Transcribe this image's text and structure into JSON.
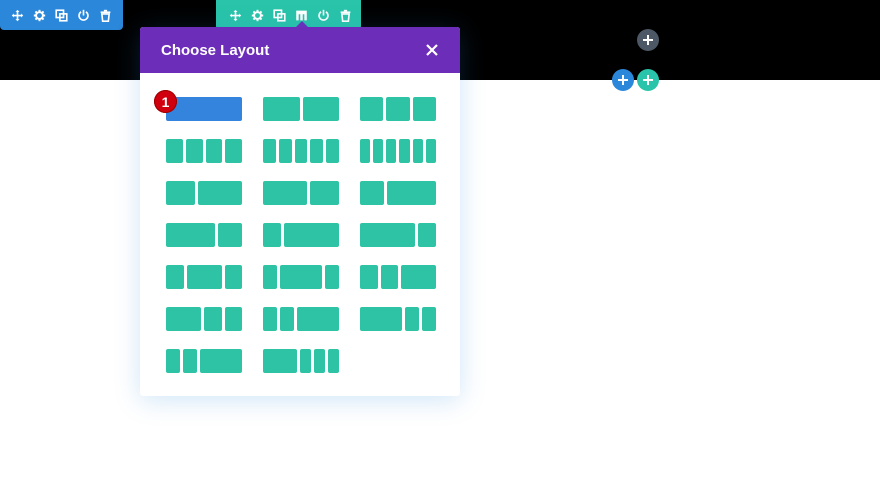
{
  "colors": {
    "section_toolbar": "#2b87da",
    "row_toolbar": "#29c4a9",
    "modal_header": "#6c2eb9",
    "layout_column": "#2fc3a5",
    "layout_selected": "#3483dc",
    "badge": "#d1000e"
  },
  "section_toolbar": {
    "icons": [
      "move-icon",
      "gear-icon",
      "duplicate-icon",
      "power-icon",
      "trash-icon"
    ]
  },
  "row_toolbar": {
    "icons": [
      "move-icon",
      "gear-icon",
      "duplicate-icon",
      "columns-icon",
      "power-icon",
      "trash-icon"
    ]
  },
  "modal": {
    "title": "Choose Layout",
    "close_icon": "close-icon",
    "badge": "1",
    "layouts": [
      {
        "id": "1",
        "cols": [
          1
        ],
        "selected": true
      },
      {
        "id": "1_2,1_2",
        "cols": [
          1,
          1
        ]
      },
      {
        "id": "1_3,1_3,1_3",
        "cols": [
          1,
          1,
          1
        ]
      },
      {
        "id": "1_4x4",
        "cols": [
          1,
          1,
          1,
          1
        ]
      },
      {
        "id": "1_5x5",
        "cols": [
          1,
          1,
          1,
          1,
          1
        ]
      },
      {
        "id": "1_6x6",
        "cols": [
          1,
          1,
          1,
          1,
          1,
          1
        ]
      },
      {
        "id": "2_5,3_5",
        "cols": [
          2,
          3
        ]
      },
      {
        "id": "3_5,2_5",
        "cols": [
          3,
          2
        ]
      },
      {
        "id": "1_3,2_3",
        "cols": [
          1,
          2
        ]
      },
      {
        "id": "2_3,1_3",
        "cols": [
          2,
          1
        ]
      },
      {
        "id": "1_4,3_4",
        "cols": [
          1,
          3
        ]
      },
      {
        "id": "3_4,1_4",
        "cols": [
          3,
          1
        ]
      },
      {
        "id": "1_4,1_2,1_4",
        "cols": [
          1,
          2,
          1
        ]
      },
      {
        "id": "1_5,3_5,1_5",
        "cols": [
          1,
          3,
          1
        ]
      },
      {
        "id": "1_4,1_4,1_2",
        "cols": [
          1,
          1,
          2
        ]
      },
      {
        "id": "1_2,1_4,1_4",
        "cols": [
          2,
          1,
          1
        ]
      },
      {
        "id": "1_5,1_5,3_5",
        "cols": [
          1,
          1,
          3
        ]
      },
      {
        "id": "3_5,1_5,1_5",
        "cols": [
          3,
          1,
          1
        ]
      },
      {
        "id": "1_6x3,1_2",
        "cols": [
          1,
          1,
          3
        ]
      },
      {
        "id": "1_2,1_6x3",
        "cols": [
          3,
          1,
          1,
          1
        ]
      }
    ]
  }
}
